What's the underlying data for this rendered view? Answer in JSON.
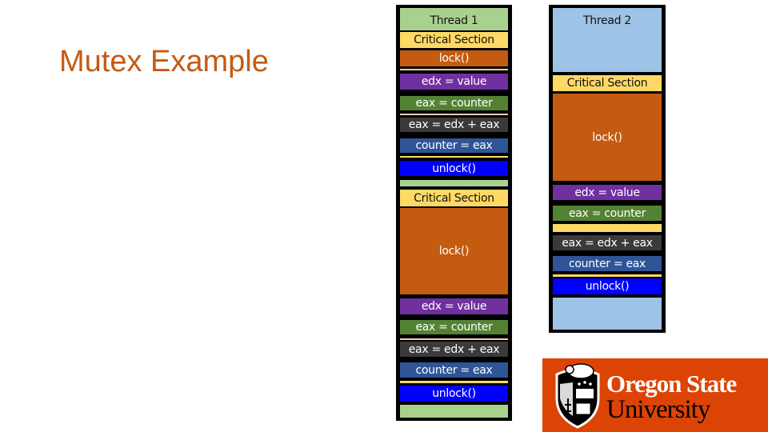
{
  "slide": {
    "title": "Mutex Example",
    "colors": {
      "title": "#c55a11",
      "thread1_bg": "#a9d18e",
      "thread2_bg": "#9dc3e6",
      "critical_section": "#ffd966",
      "lock": "#c55a11",
      "edx_value": "#7030a0",
      "eax_counter": "#548235",
      "eax_add": "#3a3a3a",
      "counter_eax": "#2f5597",
      "unlock": "#0000ff",
      "logo_bg": "#dc4405"
    }
  },
  "thread1": {
    "label": "Thread 1",
    "blocks": [
      {
        "text": "Critical Section",
        "kind": "critical_section"
      },
      {
        "text": "lock()",
        "kind": "lock"
      },
      {
        "text": "edx = value",
        "kind": "edx_value"
      },
      {
        "text": "eax = counter",
        "kind": "eax_counter"
      },
      {
        "text": "eax = edx + eax",
        "kind": "eax_add"
      },
      {
        "text": "counter = eax",
        "kind": "counter_eax"
      },
      {
        "text": "unlock()",
        "kind": "unlock"
      },
      {
        "text": "Critical Section",
        "kind": "critical_section"
      },
      {
        "text": "lock()",
        "kind": "lock"
      },
      {
        "text": "edx = value",
        "kind": "edx_value"
      },
      {
        "text": "eax = counter",
        "kind": "eax_counter"
      },
      {
        "text": "eax = edx + eax",
        "kind": "eax_add"
      },
      {
        "text": "counter = eax",
        "kind": "counter_eax"
      },
      {
        "text": "unlock()",
        "kind": "unlock"
      }
    ]
  },
  "thread2": {
    "label": "Thread 2",
    "blocks": [
      {
        "text": "Critical Section",
        "kind": "critical_section"
      },
      {
        "text": "lock()",
        "kind": "lock"
      },
      {
        "text": "edx = value",
        "kind": "edx_value"
      },
      {
        "text": "eax = counter",
        "kind": "eax_counter"
      },
      {
        "text": "eax = edx + eax",
        "kind": "eax_add"
      },
      {
        "text": "counter = eax",
        "kind": "counter_eax"
      },
      {
        "text": "unlock()",
        "kind": "unlock"
      }
    ]
  },
  "logo": {
    "line1": "Oregon State",
    "line2": "University",
    "icon": "beaver-shield-icon"
  }
}
